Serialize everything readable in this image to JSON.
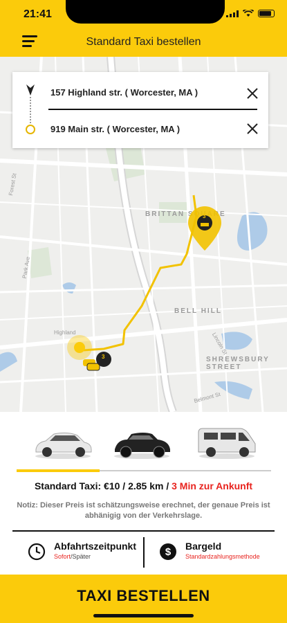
{
  "status": {
    "time": "21:41"
  },
  "header": {
    "title": "Standard Taxi bestellen"
  },
  "route": {
    "pickup": "157 Highland str. ( Worcester, MA )",
    "destination": "919 Main str. ( Worcester, MA )"
  },
  "map": {
    "labels": [
      "BRITTAN SQUARE",
      "BELL HILL",
      "SHREWSBURY STREET"
    ],
    "streets": [
      "Highland",
      "Park Ave",
      "Lincoln St",
      "Belmont St",
      "Forest St"
    ],
    "taxi_count_badges": [
      "3",
      "3"
    ]
  },
  "vehicles": [
    "Standard",
    "Premium",
    "Van"
  ],
  "fare": {
    "label": "Standard Taxi: €10 / 2.85 km / ",
    "eta": "3 Min zur Ankunft"
  },
  "note": "Notiz: Dieser Preis ist schätzungsweise erechnet, der genaue Preis ist abhänigig von der Verkehrslage.",
  "options": {
    "departure_title": "Abfahrtszeitpunkt",
    "departure_now": "Sofort",
    "departure_sep": "/",
    "departure_later": "Später",
    "payment_title": "Bargeld",
    "payment_sub": "Standardzahlungsmethode"
  },
  "order_button": "TAXI BESTELLEN",
  "colors": {
    "accent": "#fbcb0b",
    "eta": "#e8231e",
    "route": "#f2c200"
  }
}
